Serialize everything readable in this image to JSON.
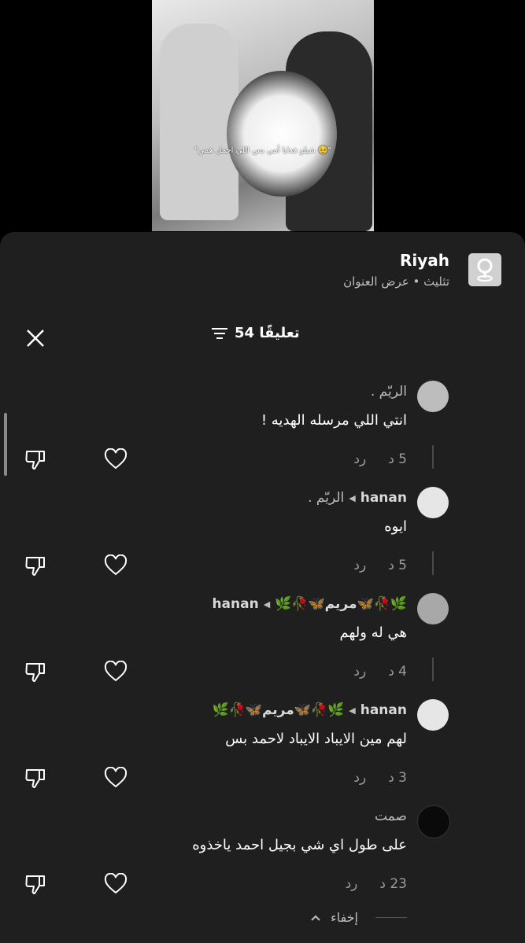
{
  "video": {
    "caption": "\"شيلو هدايا أمي بس اللي احمل همي 🥹\""
  },
  "song": {
    "title": "Riyah",
    "subtitle": "تثليث • عرض العنوان"
  },
  "header": {
    "count_label": "54 تعليقًا"
  },
  "comments": [
    {
      "author": "الريّم .",
      "reply_to": "",
      "text": "انتي اللي مرسله الهديه !",
      "time": "5 د",
      "reply": "رد",
      "avatar_color": "#c9c9c9"
    },
    {
      "author": "hanan",
      "reply_to": "الريّم .",
      "text": "ايوه",
      "time": "5 د",
      "reply": "رد",
      "avatar_color": "#e6e6e6"
    },
    {
      "author": "🌿🥀🦋مريم🦋🥀🌿",
      "reply_to": "hanan",
      "text": "هي له ولهم",
      "time": "4 د",
      "reply": "رد",
      "avatar_color": "#a8a8a8"
    },
    {
      "author": "hanan",
      "reply_to": "🌿🥀🦋مريم🦋🥀🌿",
      "text": "لهم مين الايباد الايباد لاحمد بس",
      "time": "3 د",
      "reply": "رد",
      "avatar_color": "#e6e6e6"
    },
    {
      "author": "صمت",
      "reply_to": "",
      "text": "على طول اي شي بجيل احمد ياخذوه",
      "time": "23 د",
      "reply": "رد",
      "avatar_color": "#0a0a0a"
    }
  ],
  "hide_label": "إخفاء"
}
